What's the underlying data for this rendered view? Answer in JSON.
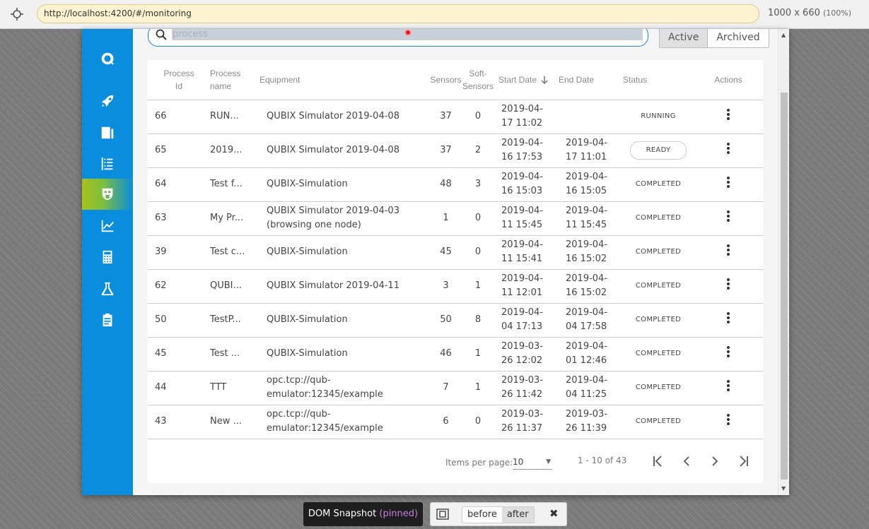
{
  "browser": {
    "url": "http://localhost:4200/#/monitoring",
    "dimensions": "1000 x 660",
    "zoom": "(100%)"
  },
  "sidebar": {
    "items": [
      {
        "name": "logo-icon",
        "active": false
      },
      {
        "name": "rocket-icon",
        "active": false
      },
      {
        "name": "report-icon",
        "active": false
      },
      {
        "name": "list-icon",
        "active": false
      },
      {
        "name": "shield-icon",
        "active": true
      },
      {
        "name": "chart-line-icon",
        "active": false
      },
      {
        "name": "calculator-icon",
        "active": false
      },
      {
        "name": "flask-icon",
        "active": false
      },
      {
        "name": "clipboard-icon",
        "active": false
      }
    ],
    "active_color": "#a8c21c",
    "bg_color": "#0a8ddc"
  },
  "search": {
    "placeholder": "process"
  },
  "toggle": {
    "active_label": "Active",
    "archived_label": "Archived"
  },
  "table": {
    "headers": {
      "process_id": "Process Id",
      "process_name": "Process name",
      "equipment": "Equipment",
      "sensors": "Sensors",
      "soft_sensors": "Soft-Sensors",
      "start_date": "Start Date",
      "end_date": "End Date",
      "status": "Status",
      "actions": "Actions"
    },
    "rows": [
      {
        "id": "66",
        "name": "RUN...",
        "equipment": "QUBIX Simulator 2019-04-08",
        "sensors": "37",
        "soft": "0",
        "start": "2019-04-17 11:02",
        "end": "",
        "status": "RUNNING"
      },
      {
        "id": "65",
        "name": "2019...",
        "equipment": "QUBIX Simulator 2019-04-08",
        "sensors": "37",
        "soft": "2",
        "start": "2019-04-16 17:53",
        "end": "2019-04-17 11:01",
        "status": "READY"
      },
      {
        "id": "64",
        "name": "Test f...",
        "equipment": "QUBIX-Simulation",
        "sensors": "48",
        "soft": "3",
        "start": "2019-04-16 15:03",
        "end": "2019-04-16 15:05",
        "status": "COMPLETED"
      },
      {
        "id": "63",
        "name": "My Pr...",
        "equipment": "QUBIX Simulator 2019-04-03 (browsing one node)",
        "sensors": "1",
        "soft": "0",
        "start": "2019-04-11 15:45",
        "end": "2019-04-11 15:45",
        "status": "COMPLETED"
      },
      {
        "id": "39",
        "name": "Test c...",
        "equipment": "QUBIX-Simulation",
        "sensors": "45",
        "soft": "0",
        "start": "2019-04-11 15:41",
        "end": "2019-04-16 15:02",
        "status": "COMPLETED"
      },
      {
        "id": "62",
        "name": "QUBI...",
        "equipment": "QUBIX Simulator 2019-04-11",
        "sensors": "3",
        "soft": "1",
        "start": "2019-04-11 12:01",
        "end": "2019-04-16 15:02",
        "status": "COMPLETED"
      },
      {
        "id": "50",
        "name": "TestP...",
        "equipment": "QUBIX-Simulation",
        "sensors": "50",
        "soft": "8",
        "start": "2019-04-04 17:13",
        "end": "2019-04-04 17:58",
        "status": "COMPLETED"
      },
      {
        "id": "45",
        "name": "Test ...",
        "equipment": "QUBIX-Simulation",
        "sensors": "46",
        "soft": "1",
        "start": "2019-03-26 12:02",
        "end": "2019-04-01 12:46",
        "status": "COMPLETED"
      },
      {
        "id": "44",
        "name": "TTT",
        "equipment": "opc.tcp://qub-emulator:12345/example",
        "sensors": "7",
        "soft": "1",
        "start": "2019-03-26 11:42",
        "end": "2019-04-04 11:25",
        "status": "COMPLETED"
      },
      {
        "id": "43",
        "name": "New ...",
        "equipment": "opc.tcp://qub-emulator:12345/example",
        "sensors": "6",
        "soft": "0",
        "start": "2019-03-26 11:37",
        "end": "2019-03-26 11:39",
        "status": "COMPLETED"
      }
    ]
  },
  "paginator": {
    "items_per_page_label": "Items per page:",
    "items_per_page_value": "10",
    "range_label": "1 - 10 of 43"
  },
  "snapshot_bar": {
    "title": "DOM Snapshot",
    "pinned": "(pinned)",
    "before_label": "before",
    "after_label": "after",
    "close_label": "✖"
  }
}
